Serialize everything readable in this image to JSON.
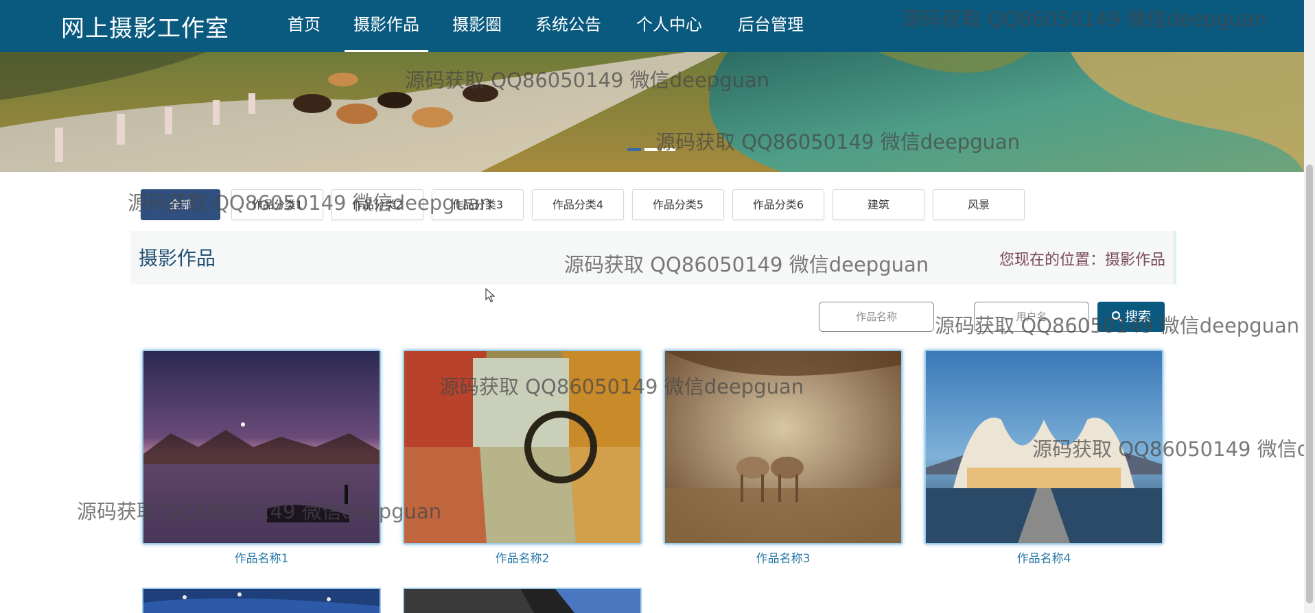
{
  "nav": {
    "brand": "网上摄影工作室",
    "items": [
      {
        "label": "首页"
      },
      {
        "label": "摄影作品"
      },
      {
        "label": "摄影圈"
      },
      {
        "label": "系统公告"
      },
      {
        "label": "个人中心"
      },
      {
        "label": "后台管理"
      }
    ],
    "active_index": 1
  },
  "banner": {
    "slide_count": 3,
    "active_slide": 1
  },
  "categories": [
    {
      "label": "全部",
      "active": true
    },
    {
      "label": "作品分类1"
    },
    {
      "label": "作品分类2"
    },
    {
      "label": "作品分类3"
    },
    {
      "label": "作品分类4"
    },
    {
      "label": "作品分类5"
    },
    {
      "label": "作品分类6"
    },
    {
      "label": "建筑"
    },
    {
      "label": "风景"
    }
  ],
  "section": {
    "title": "摄影作品",
    "breadcrumb_prefix": "您现在的位置：",
    "breadcrumb_current": "摄影作品"
  },
  "search": {
    "name_placeholder": "作品名称",
    "user_placeholder": "用户名",
    "button_label": "搜索"
  },
  "works": [
    {
      "name": "作品名称1"
    },
    {
      "name": "作品名称2"
    },
    {
      "name": "作品名称3"
    },
    {
      "name": "作品名称4"
    }
  ],
  "watermark": "源码获取 QQ86050149 微信deepguan",
  "colors": {
    "nav_bg": "#0a5a80",
    "category_active": "#2f4f7f",
    "card_border": "#9bcbe7",
    "work_name": "#2a79a8"
  }
}
